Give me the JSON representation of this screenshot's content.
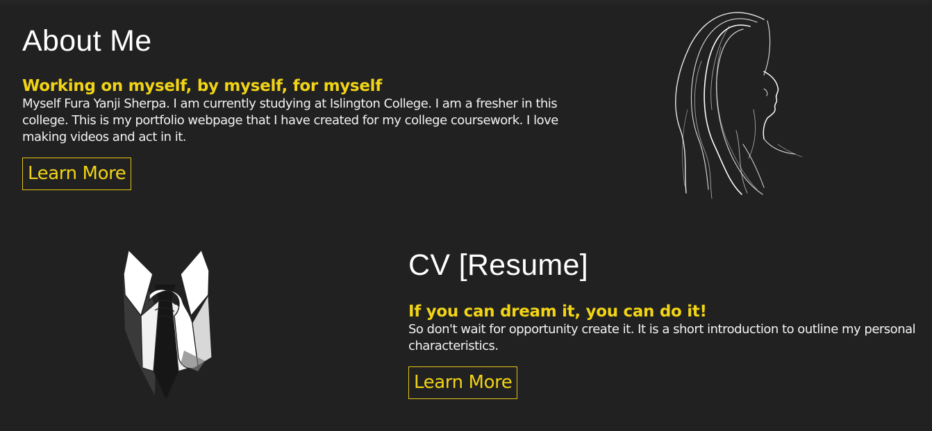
{
  "about": {
    "heading": "About Me",
    "tagline": "Working on myself, by myself, for myself",
    "body": "Myself Fura Yanji Sherpa. I am currently studying at Islington College. I am a fresher in this college. This is my portfolio webpage that I have created for my college coursework. I love making videos and act in it.",
    "button_label": "Learn More",
    "image": "woman-profile-sketch"
  },
  "cv": {
    "heading": "CV [Resume]",
    "tagline": "If you can dream it, you can do it!",
    "body": "So don't wait for opportunity create it. It is a short introduction to outline my personal characteristics.",
    "button_label": "Learn More",
    "image": "suit-tie-illustration"
  },
  "colors": {
    "background": "#212121",
    "accent": "#f2d416",
    "text": "#ffffff"
  }
}
